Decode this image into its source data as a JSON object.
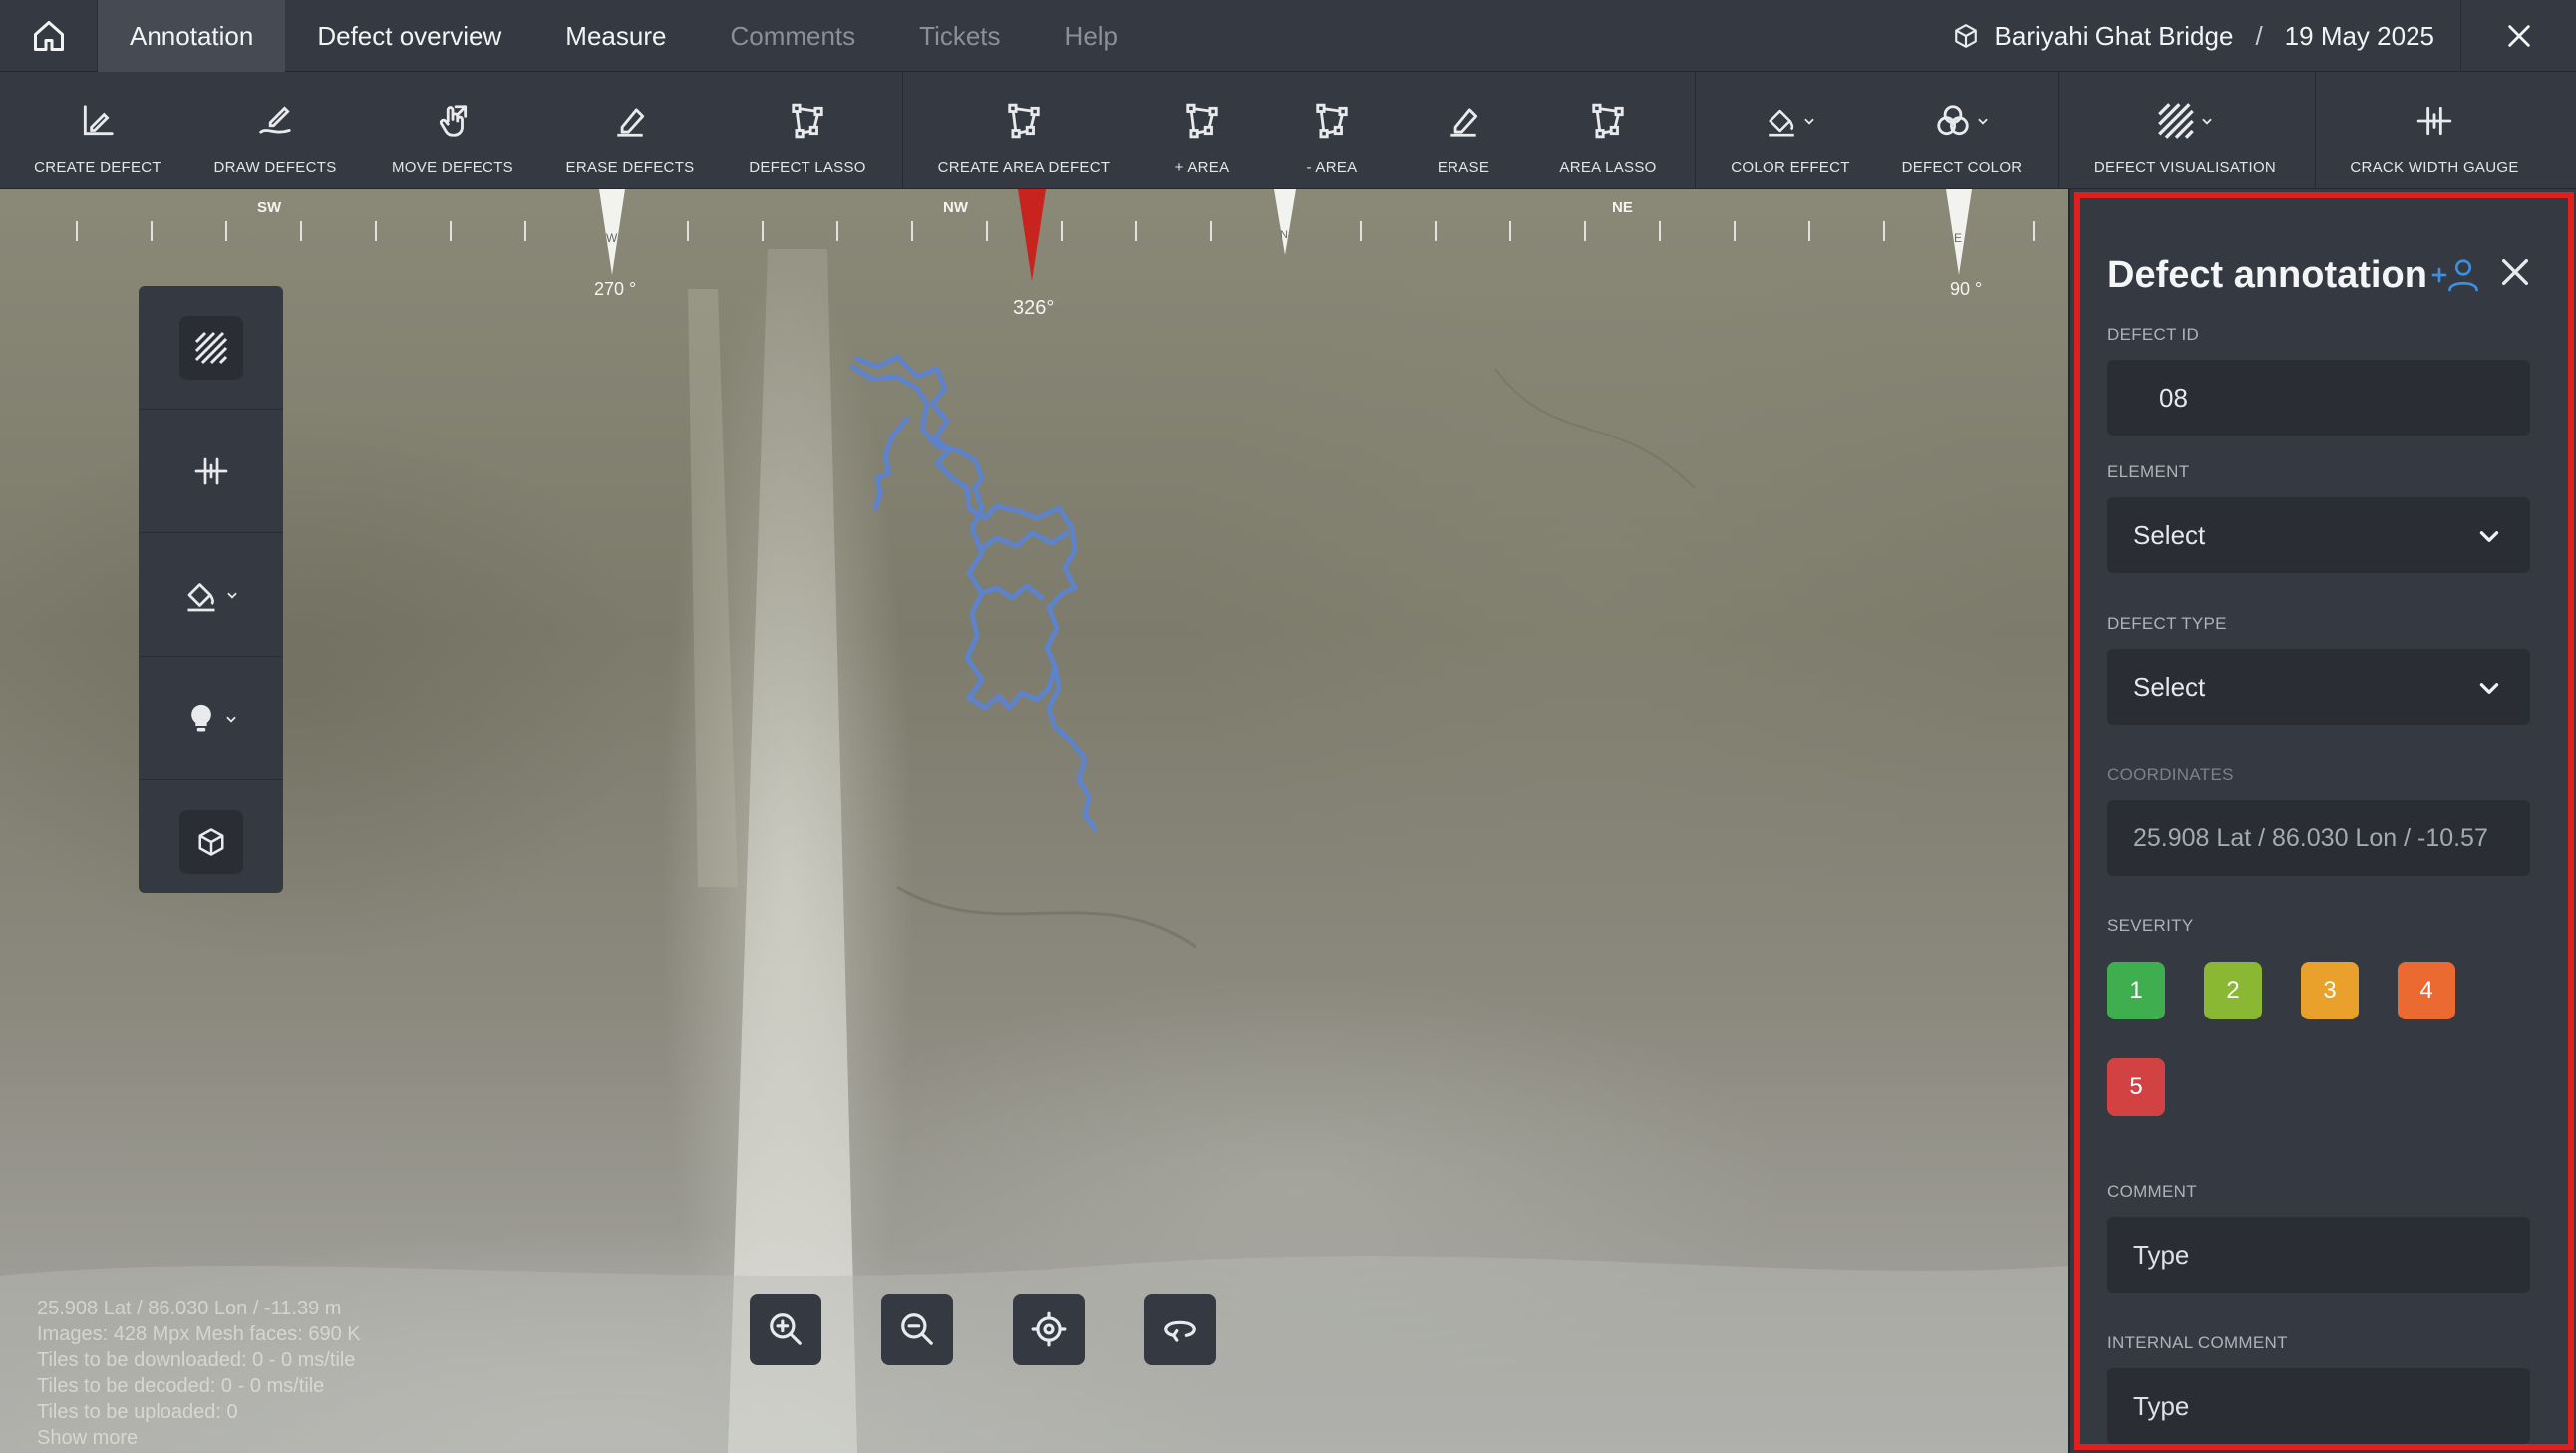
{
  "nav": {
    "tabs": [
      {
        "label": "Annotation",
        "active": true
      },
      {
        "label": "Defect overview"
      },
      {
        "label": "Measure"
      },
      {
        "label": "Comments",
        "disabled": true
      },
      {
        "label": "Tickets",
        "disabled": true
      },
      {
        "label": "Help",
        "disabled": true
      }
    ],
    "project_name": "Bariyahi Ghat Bridge",
    "separator": "/",
    "date": "19 May 2025"
  },
  "toolbar": {
    "tools": [
      {
        "label": "CREATE DEFECT",
        "icon": "create-defect-icon"
      },
      {
        "label": "DRAW DEFECTS",
        "icon": "draw-defects-icon"
      },
      {
        "label": "MOVE DEFECTS",
        "icon": "move-defects-icon"
      },
      {
        "label": "ERASE DEFECTS",
        "icon": "erase-defects-icon"
      },
      {
        "label": "DEFECT LASSO",
        "icon": "lasso-icon"
      },
      {
        "label": "CREATE AREA DEFECT",
        "icon": "create-area-icon"
      },
      {
        "label": "+ AREA",
        "icon": "add-area-icon"
      },
      {
        "label": "- AREA",
        "icon": "remove-area-icon"
      },
      {
        "label": "ERASE",
        "icon": "erase-icon"
      },
      {
        "label": "AREA LASSO",
        "icon": "area-lasso-icon"
      },
      {
        "label": "COLOR EFFECT",
        "icon": "paint-bucket-icon"
      },
      {
        "label": "DEFECT COLOR",
        "icon": "defect-color-icon"
      },
      {
        "label": "DEFECT VISUALISATION",
        "icon": "hatch-icon"
      },
      {
        "label": "CRACK WIDTH GAUGE",
        "icon": "crack-gauge-icon"
      }
    ]
  },
  "compass": {
    "labels": [
      "SW",
      "NW",
      "NE"
    ],
    "markers": [
      {
        "label": "270 °",
        "type": "west",
        "letter": "W"
      },
      {
        "label": "326°",
        "type": "current"
      },
      {
        "label": "",
        "type": "north",
        "letter": "N"
      },
      {
        "label": "90 °",
        "type": "east",
        "letter": "E"
      }
    ],
    "current_color": "#c8231f"
  },
  "stats": {
    "lines": [
      "25.908 Lat / 86.030 Lon / -11.39 m",
      "Images: 428 Mpx    Mesh faces: 690 K",
      "Tiles to be downloaded: 0 - 0 ms/tile",
      "Tiles to be decoded: 0 - 0 ms/tile",
      "Tiles to be uploaded: 0",
      "Show more"
    ]
  },
  "panel": {
    "title": "Defect annotation",
    "defect_id_label": "DEFECT ID",
    "defect_id_value": "08",
    "element_label": "ELEMENT",
    "element_value": "Select",
    "defect_type_label": "DEFECT TYPE",
    "defect_type_value": "Select",
    "coordinates_label": "COORDINATES",
    "coordinates_value": "25.908 Lat / 86.030 Lon / -10.57",
    "severity_label": "SEVERITY",
    "severity": [
      {
        "label": "1",
        "color": "#3fae4f"
      },
      {
        "label": "2",
        "color": "#8ab833"
      },
      {
        "label": "3",
        "color": "#e9a12c"
      },
      {
        "label": "4",
        "color": "#ea6a31"
      },
      {
        "label": "5",
        "color": "#d24242"
      }
    ],
    "comment_label": "COMMENT",
    "comment_placeholder": "Type",
    "internal_comment_label": "INTERNAL COMMENT",
    "internal_comment_placeholder": "Type",
    "highlight_color": "#e11f1f",
    "accent_color": "#3d8fe0"
  },
  "crack_color": "#5a84d6"
}
